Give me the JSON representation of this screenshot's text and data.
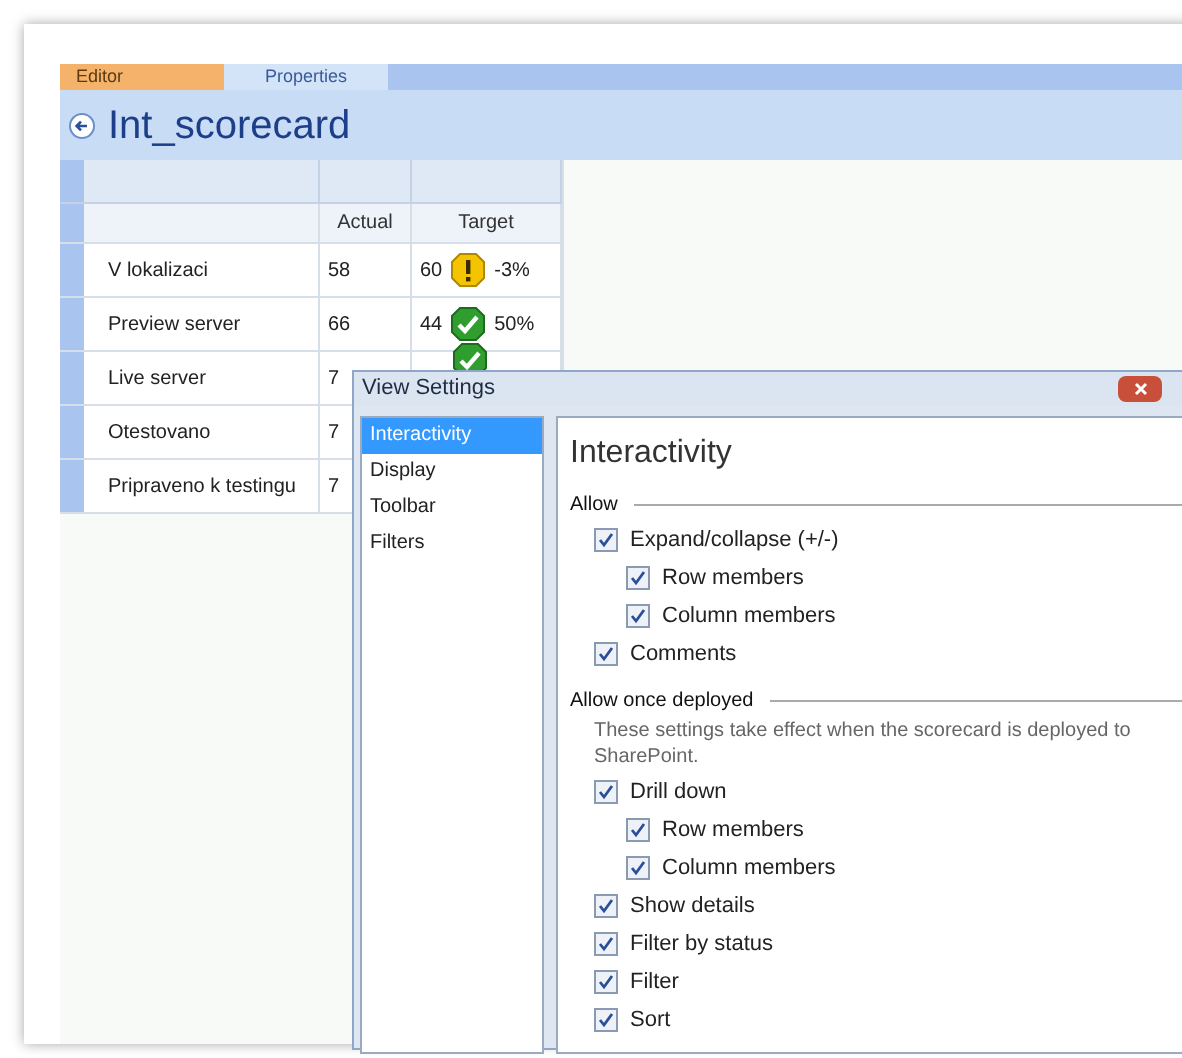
{
  "tabs": [
    {
      "label": "Editor",
      "selected": true
    },
    {
      "label": "Properties",
      "selected": false
    }
  ],
  "title": "Int_scorecard",
  "table": {
    "columns": [
      "Actual",
      "Target"
    ],
    "rows": [
      {
        "name": "V lokalizaci",
        "actual": "58",
        "target": {
          "value": "60",
          "kind": "warning",
          "change": "-3%"
        }
      },
      {
        "name": "Preview server",
        "actual": "66",
        "target": {
          "value": "44",
          "kind": "ok",
          "change": "50%"
        }
      },
      {
        "name": "Live server",
        "actual": "7",
        "target": {
          "kind": "ok"
        }
      },
      {
        "name": "Otestovano",
        "actual": "7"
      },
      {
        "name": "Pripraveno k testingu",
        "actual": "7"
      }
    ]
  },
  "dialog": {
    "title": "View Settings",
    "nav": [
      {
        "label": "Interactivity",
        "selected": true
      },
      {
        "label": "Display",
        "selected": false
      },
      {
        "label": "Toolbar",
        "selected": false
      },
      {
        "label": "Filters",
        "selected": false
      }
    ],
    "heading": "Interactivity",
    "groups": [
      {
        "label": "Allow",
        "items": [
          {
            "label": "Expand/collapse (+/-)",
            "checked": true,
            "children": [
              {
                "label": "Row members",
                "checked": true
              },
              {
                "label": "Column members",
                "checked": true
              }
            ]
          },
          {
            "label": "Comments",
            "checked": true
          }
        ]
      },
      {
        "label": "Allow once deployed",
        "note": "These settings take effect when the scorecard is deployed to SharePoint.",
        "items": [
          {
            "label": "Drill down",
            "checked": true,
            "children": [
              {
                "label": "Row members",
                "checked": true
              },
              {
                "label": "Column members",
                "checked": true
              }
            ]
          },
          {
            "label": "Show details",
            "checked": true
          },
          {
            "label": "Filter by status",
            "checked": true
          },
          {
            "label": "Filter",
            "checked": true
          },
          {
            "label": "Sort",
            "checked": true
          }
        ]
      }
    ]
  }
}
